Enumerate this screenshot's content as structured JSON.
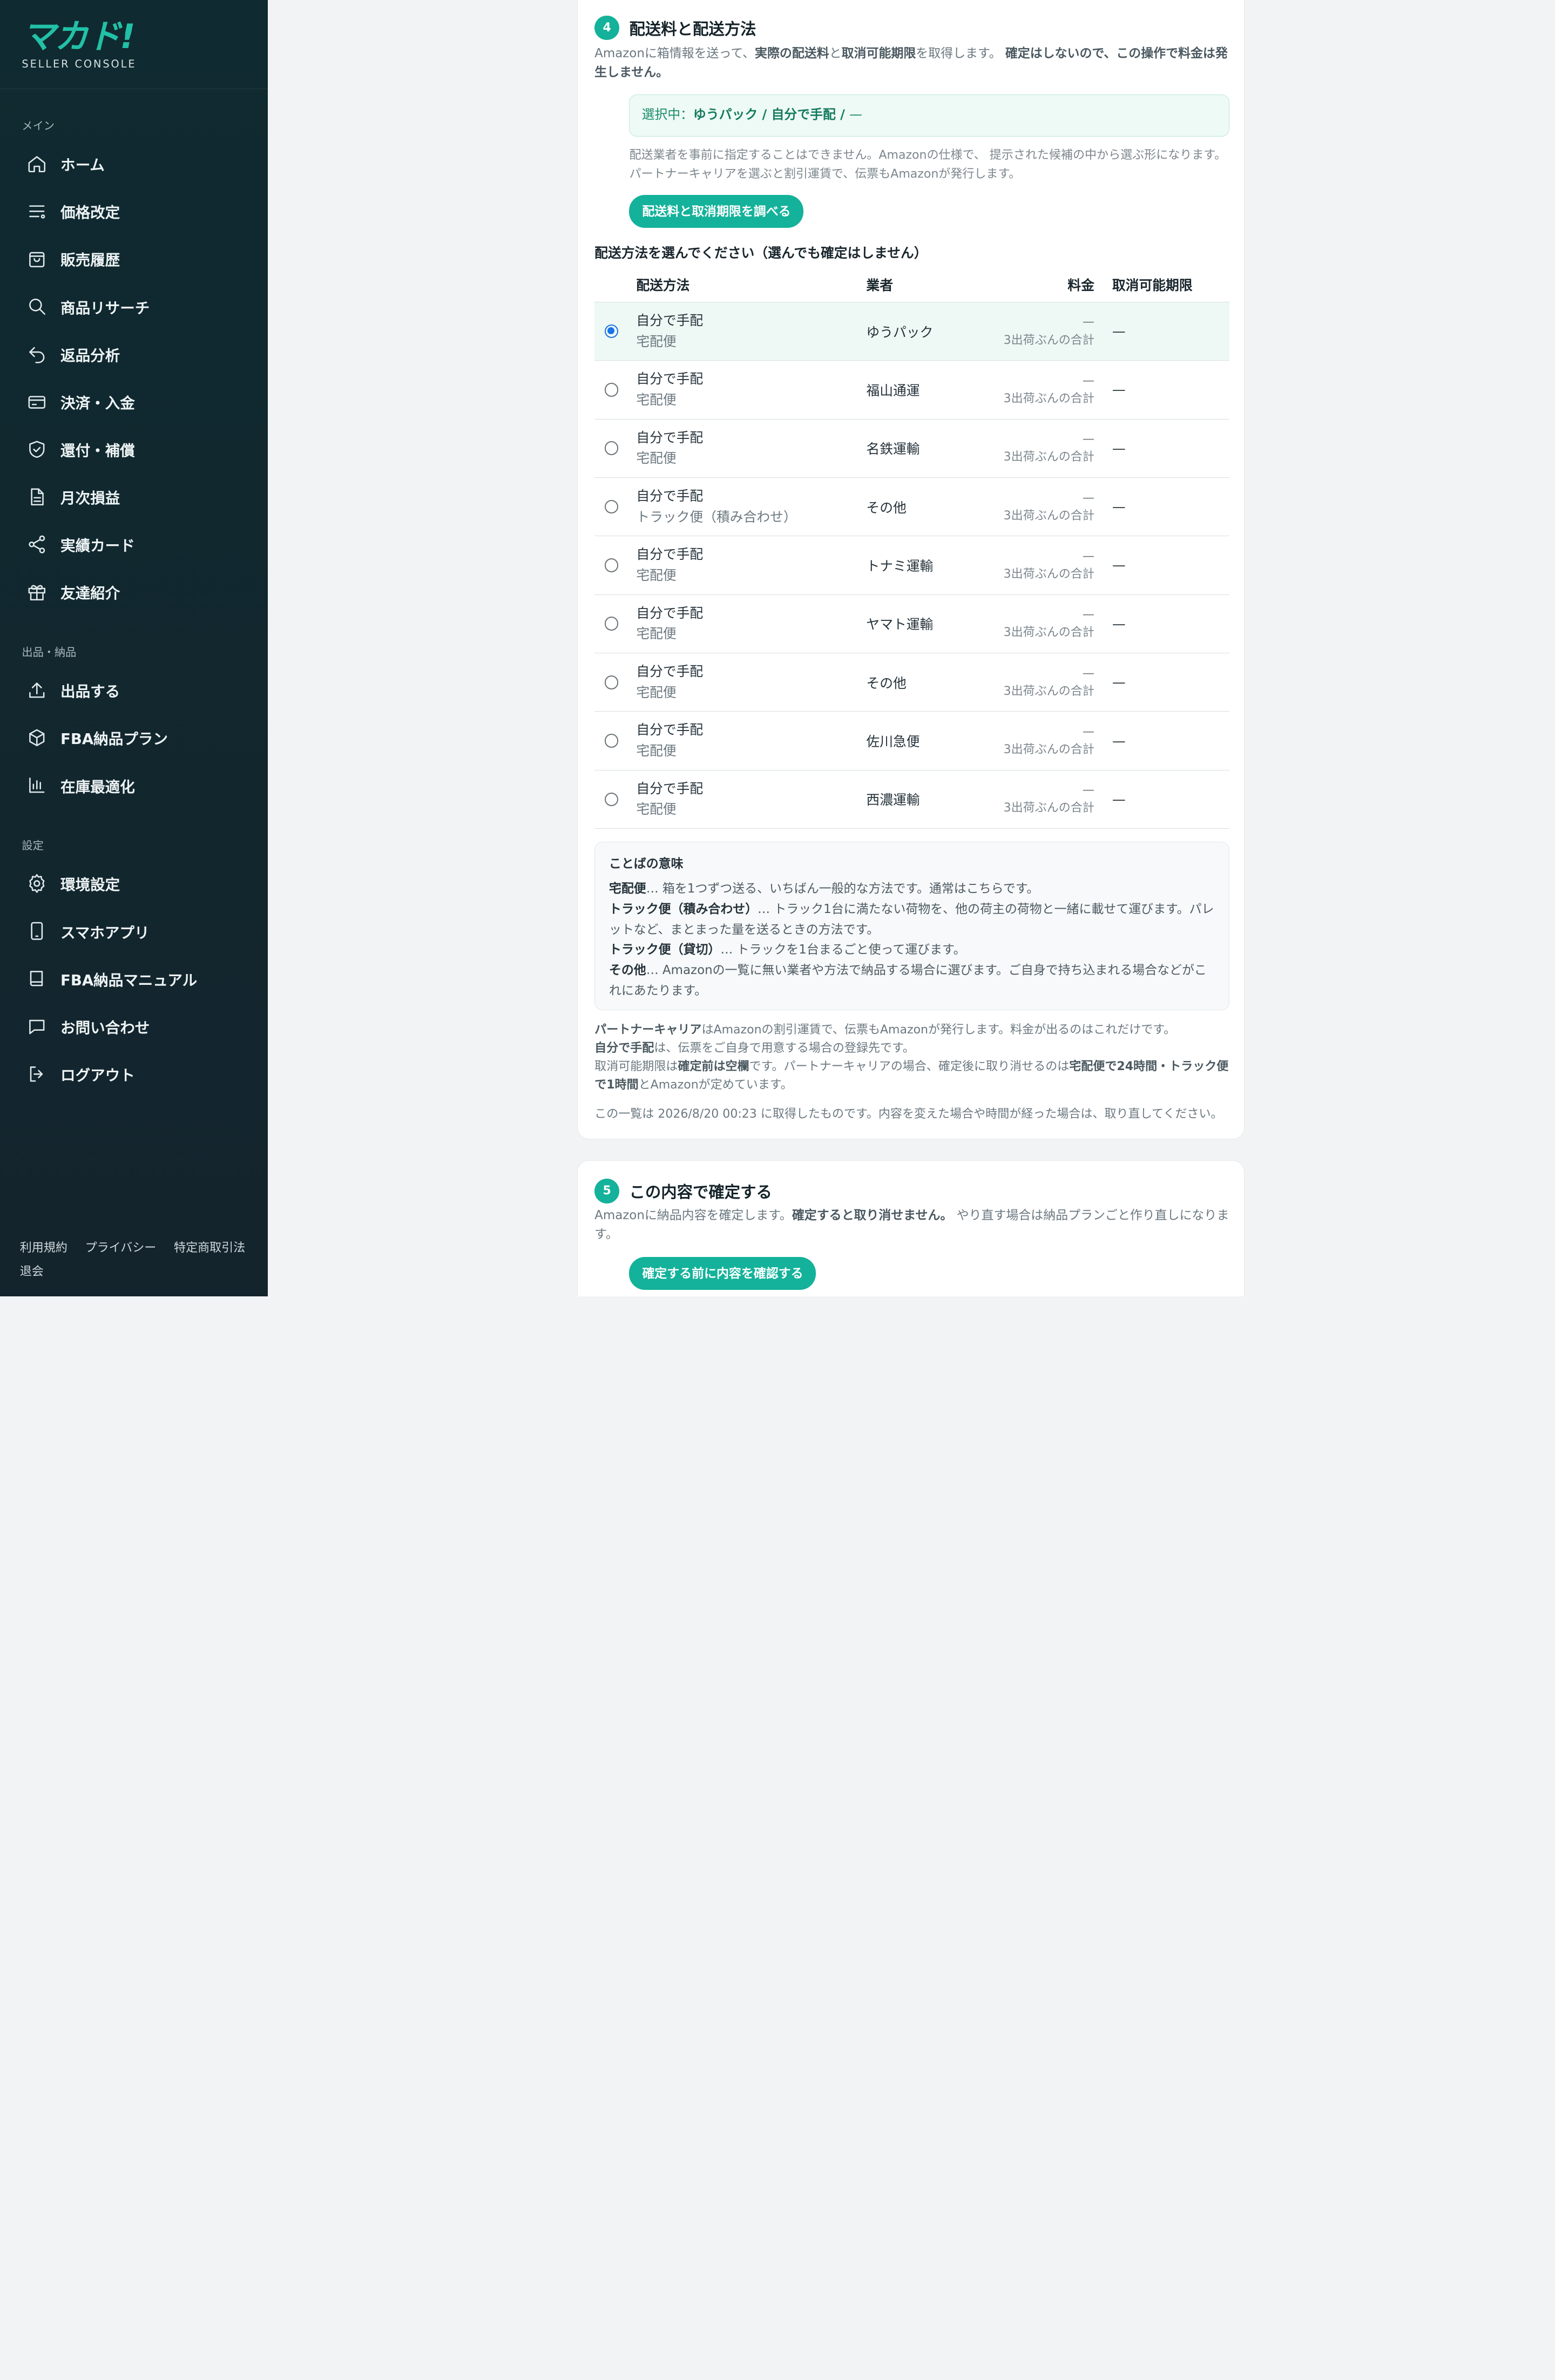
{
  "brand": {
    "logo": "マカド!",
    "subtitle": "SELLER CONSOLE"
  },
  "sidebar": {
    "sections": [
      {
        "title": "メイン",
        "items": [
          {
            "label": "ホーム",
            "icon": "home-icon"
          },
          {
            "label": "価格改定",
            "icon": "list-icon"
          },
          {
            "label": "販売履歴",
            "icon": "bag-icon"
          },
          {
            "label": "商品リサーチ",
            "icon": "search-icon"
          },
          {
            "label": "返品分析",
            "icon": "return-icon"
          },
          {
            "label": "決済・入金",
            "icon": "card-icon"
          },
          {
            "label": "還付・補償",
            "icon": "shield-check-icon"
          },
          {
            "label": "月次損益",
            "icon": "document-icon"
          },
          {
            "label": "実績カード",
            "icon": "share-icon"
          },
          {
            "label": "友達紹介",
            "icon": "gift-icon"
          }
        ]
      },
      {
        "title": "出品・納品",
        "items": [
          {
            "label": "出品する",
            "icon": "upload-icon"
          },
          {
            "label": "FBA納品プラン",
            "icon": "box-icon"
          },
          {
            "label": "在庫最適化",
            "icon": "bar-chart-icon"
          }
        ]
      },
      {
        "title": "設定",
        "items": [
          {
            "label": "環境設定",
            "icon": "gear-icon"
          },
          {
            "label": "スマホアプリ",
            "icon": "phone-icon"
          },
          {
            "label": "FBA納品マニュアル",
            "icon": "book-icon"
          },
          {
            "label": "お問い合わせ",
            "icon": "chat-icon"
          },
          {
            "label": "ログアウト",
            "icon": "logout-icon"
          }
        ]
      }
    ],
    "footer": {
      "terms": "利用規約",
      "privacy": "プライバシー",
      "commerce": "特定商取引法",
      "withdraw": "退会"
    }
  },
  "step4": {
    "number": "4",
    "title": "配送料と配送方法",
    "desc_1": "Amazonに箱情報を送って、",
    "desc_b1": "実際の配送料",
    "desc_2": "と",
    "desc_b2": "取消可能期限",
    "desc_3": "を取得します。 ",
    "desc_b3": "確定はしないので、この操作で料金は発生しません。",
    "selected_prefix": "選択中：",
    "selected_value": "ゆうパック / 自分で手配 / ",
    "selected_suffix": "—",
    "note_1": "配送業者を事前に指定することはできません。Amazonの仕様で、 提示された候補の中から選ぶ形になります。",
    "note_2": "パートナーキャリアを選ぶと割引運賃で、伝票もAmazonが発行します。",
    "check_button": "配送料と取消期限を調べる",
    "list_heading": "配送方法を選んでください（選んでも確定はしません）",
    "columns": {
      "method": "配送方法",
      "carrier": "業者",
      "fee": "料金",
      "deadline": "取消可能期限"
    },
    "rows": [
      {
        "method": "自分で手配",
        "type": "宅配便",
        "carrier": "ゆうパック",
        "fee": "—",
        "fee_note": "3出荷ぶんの合計",
        "deadline": "—",
        "selected": true
      },
      {
        "method": "自分で手配",
        "type": "宅配便",
        "carrier": "福山通運",
        "fee": "—",
        "fee_note": "3出荷ぶんの合計",
        "deadline": "—",
        "selected": false
      },
      {
        "method": "自分で手配",
        "type": "宅配便",
        "carrier": "名鉄運輸",
        "fee": "—",
        "fee_note": "3出荷ぶんの合計",
        "deadline": "—",
        "selected": false
      },
      {
        "method": "自分で手配",
        "type": "トラック便（積み合わせ）",
        "carrier": "その他",
        "fee": "—",
        "fee_note": "3出荷ぶんの合計",
        "deadline": "—",
        "selected": false
      },
      {
        "method": "自分で手配",
        "type": "宅配便",
        "carrier": "トナミ運輸",
        "fee": "—",
        "fee_note": "3出荷ぶんの合計",
        "deadline": "—",
        "selected": false
      },
      {
        "method": "自分で手配",
        "type": "宅配便",
        "carrier": "ヤマト運輸",
        "fee": "—",
        "fee_note": "3出荷ぶんの合計",
        "deadline": "—",
        "selected": false
      },
      {
        "method": "自分で手配",
        "type": "宅配便",
        "carrier": "その他",
        "fee": "—",
        "fee_note": "3出荷ぶんの合計",
        "deadline": "—",
        "selected": false
      },
      {
        "method": "自分で手配",
        "type": "宅配便",
        "carrier": "佐川急便",
        "fee": "—",
        "fee_note": "3出荷ぶんの合計",
        "deadline": "—",
        "selected": false
      },
      {
        "method": "自分で手配",
        "type": "宅配便",
        "carrier": "西濃運輸",
        "fee": "—",
        "fee_note": "3出荷ぶんの合計",
        "deadline": "—",
        "selected": false
      }
    ],
    "terms": {
      "title": "ことばの意味",
      "t1_term": "宅配便",
      "t1_text": "… 箱を1つずつ送る、いちばん一般的な方法です。通常はこちらです。",
      "t2_term": "トラック便（積み合わせ）",
      "t2_text": "… トラック1台に満たない荷物を、他の荷主の荷物と一緒に載せて運びます。パレットなど、まとまった量を送るときの方法です。",
      "t3_term": "トラック便（貸切）",
      "t3_text": "… トラックを1台まるごと使って運びます。",
      "t4_term": "その他",
      "t4_text": "… Amazonの一覧に無い業者や方法で納品する場合に選びます。ご自身で持ち込まれる場合などがこれにあたります。"
    },
    "footnotes": {
      "f1_b": "パートナーキャリア",
      "f1": "はAmazonの割引運賃で、伝票もAmazonが発行します。料金が出るのはこれだけです。",
      "f2_b": "自分で手配",
      "f2": "は、伝票をご自身で用意する場合の登録先です。",
      "f3_a": "取消可能期限は",
      "f3_b": "確定前は空欄",
      "f3_c": "です。パートナーキャリアの場合、確定後に取り消せるのは",
      "f3_d": "宅配便で24時間・トラック便で1時間",
      "f3_e": "とAmazonが定めています。",
      "fetched": "この一覧は 2026/8/20 00:23 に取得したものです。内容を変えた場合や時間が経った場合は、取り直してください。"
    }
  },
  "step5": {
    "number": "5",
    "title": "この内容で確定する",
    "desc_1": "Amazonに納品内容を確定します。",
    "desc_b": "確定すると取り消せません。",
    "desc_2": " やり直す場合は納品プランごと作り直しになります。",
    "confirm_button": "確定する前に内容を確認する"
  },
  "colors": {
    "accent": "#14b29a",
    "sidebar_bg": "#122830",
    "radio_selected": "#1a73e8"
  }
}
